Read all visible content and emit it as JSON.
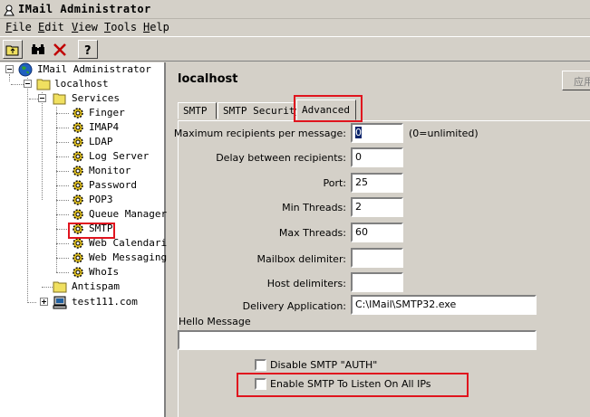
{
  "window": {
    "title": "IMail Administrator"
  },
  "menu": [
    {
      "label": "File",
      "key": "F"
    },
    {
      "label": "Edit",
      "key": "E"
    },
    {
      "label": "View",
      "key": "V"
    },
    {
      "label": "Tools",
      "key": "T"
    },
    {
      "label": "Help",
      "key": "H"
    }
  ],
  "toolbar": [
    "up-folder-icon",
    "find-icon",
    "delete-icon",
    "help-icon"
  ],
  "tree": {
    "root": "IMail Administrator",
    "host": "localhost",
    "services": "Services",
    "items": [
      "Finger",
      "IMAP4",
      "LDAP",
      "Log Server",
      "Monitor",
      "Password",
      "POP3",
      "Queue Manager",
      "SMTP",
      "Web Calendari",
      "Web Messaging",
      "WhoIs"
    ],
    "antispam": "Antispam",
    "other_host": "test111.com"
  },
  "panel": {
    "title": "localhost",
    "apply_label": "应用",
    "tabs": [
      "SMTP",
      "SMTP Security",
      "Advanced"
    ],
    "active_tab": "Advanced",
    "fields": {
      "max_recipients": {
        "label": "Maximum recipients per message:",
        "value": "0",
        "hint": "(0=unlimited)"
      },
      "delay": {
        "label": "Delay between recipients:",
        "value": "0"
      },
      "port": {
        "label": "Port:",
        "value": "25"
      },
      "min_threads": {
        "label": "Min Threads:",
        "value": "2"
      },
      "max_threads": {
        "label": "Max Threads:",
        "value": "60"
      },
      "mailbox_delim": {
        "label": "Mailbox delimiter:",
        "value": ""
      },
      "host_delim": {
        "label": "Host delimiters:",
        "value": ""
      },
      "delivery_app": {
        "label": "Delivery Application:",
        "value": "C:\\IMail\\SMTP32.exe"
      },
      "hello": {
        "label": "Hello Message",
        "value": ""
      }
    },
    "checkboxes": {
      "disable_auth": {
        "label": "Disable SMTP \"AUTH\"",
        "checked": false
      },
      "listen_all": {
        "label": "Enable SMTP To Listen On All IPs",
        "checked": false
      }
    }
  },
  "highlight_color": "#e0141e"
}
